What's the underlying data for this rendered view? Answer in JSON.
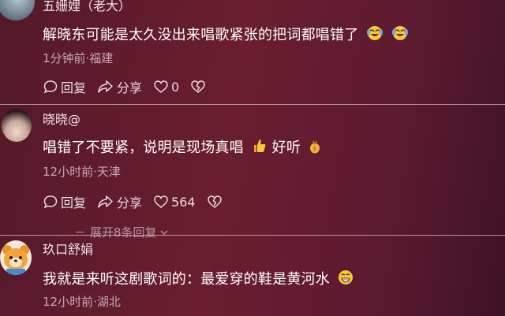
{
  "comments": [
    {
      "author": "五姗娌（老大）",
      "text": "解晓东可能是太久没出来唱歌紧张的把词都唱错了",
      "emojis": [
        "laughing-crying-emoji",
        "laughing-crying-emoji"
      ],
      "meta": "1分钟前·福建",
      "reply_label": "回复",
      "share_label": "分享",
      "like_count": "0"
    },
    {
      "author": "晓晓@",
      "text_a": "唱错了不要紧，说明是现场真唱",
      "text_b": "好听",
      "emojis": [
        "thumbs-up-emoji",
        "gift-bag-emoji"
      ],
      "meta": "12小时前·天津",
      "reply_label": "回复",
      "share_label": "分享",
      "like_count": "564",
      "expand_label": "展开8条回复"
    },
    {
      "author": "玖口舒娟",
      "text": "我就是来听这剧歌词的：最爱穿的鞋是黄河水",
      "emojis": [
        "grinning-emoji"
      ],
      "meta": "12小时前·湖北"
    }
  ],
  "colors": {
    "background": "#5e1b2d",
    "text": "#ffffff",
    "meta": "#c9a9b3"
  }
}
